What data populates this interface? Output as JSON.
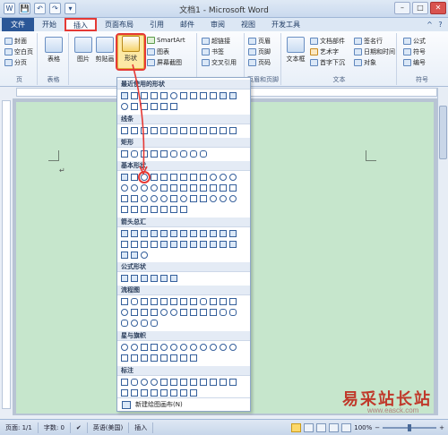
{
  "window": {
    "title": "文档1 - Microsoft Word"
  },
  "qat": [
    "W",
    "💾",
    "↶",
    "↷",
    "▾"
  ],
  "tabs": [
    {
      "label": "文件",
      "kind": "file"
    },
    {
      "label": "开始",
      "kind": "normal"
    },
    {
      "label": "插入",
      "kind": "active"
    },
    {
      "label": "页面布局",
      "kind": "normal"
    },
    {
      "label": "引用",
      "kind": "normal"
    },
    {
      "label": "邮件",
      "kind": "normal"
    },
    {
      "label": "审阅",
      "kind": "normal"
    },
    {
      "label": "视图",
      "kind": "normal"
    },
    {
      "label": "开发工具",
      "kind": "normal"
    }
  ],
  "ribbon": {
    "pages_group": {
      "label": "页",
      "items": [
        "封面",
        "空白页",
        "分页"
      ]
    },
    "table_group": {
      "label": "表格",
      "button": "表格"
    },
    "illus": {
      "picture": "图片",
      "clipart": "剪贴画",
      "shapes": "形状",
      "smartart": "SmartArt",
      "chart": "图表",
      "screenshot": "屏幕截图"
    },
    "links": {
      "hyperlink": "超链接",
      "bookmark": "书签",
      "crossref": "交叉引用"
    },
    "header_footer": {
      "label": "页眉和页脚",
      "header": "页眉",
      "footer": "页脚",
      "page_num": "页码"
    },
    "text": {
      "label": "文本",
      "textbox": "文本框",
      "parts": "文档部件",
      "wordart": "艺术字",
      "dropcap": "首字下沉",
      "signature": "签名行",
      "datetime": "日期和时间",
      "object": "对象"
    },
    "symbols": {
      "label": "符号",
      "equation": "公式",
      "symbol": "符号",
      "number": "编号"
    }
  },
  "shapes_menu": {
    "sections": [
      "最近使用的形状",
      "线条",
      "矩形",
      "基本形状",
      "箭头总汇",
      "公式形状",
      "流程图",
      "星与旗帜",
      "标注"
    ],
    "footer": "新建绘图画布(N)"
  },
  "statusbar": {
    "page": "页面: 1/1",
    "words": "字数: 0",
    "lang": "英语(美国)",
    "mode": "插入",
    "zoom": "100%"
  },
  "watermark": {
    "text": "易采站长站",
    "url": "www.easck.com"
  },
  "colors": {
    "accent": "#2b5797",
    "highlight": "#e53935",
    "page": "#c6e6cc"
  }
}
